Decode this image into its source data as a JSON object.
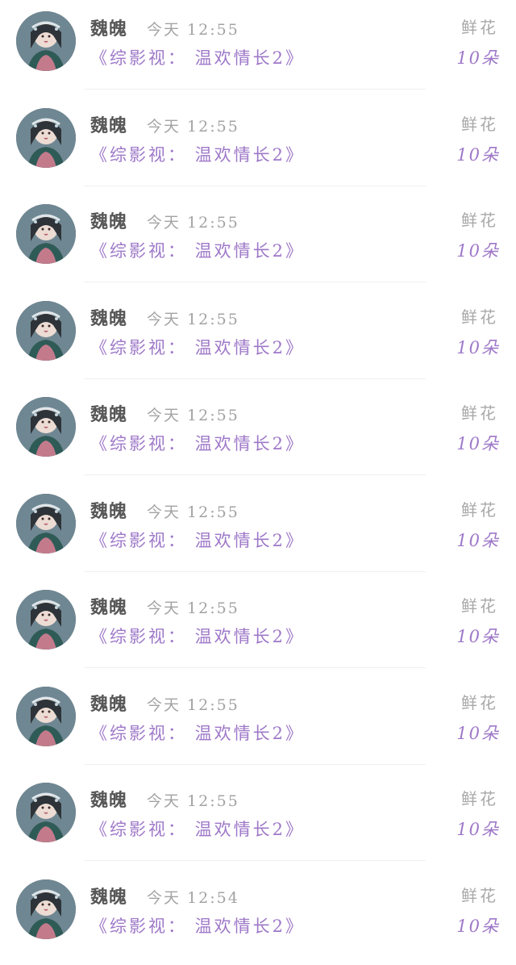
{
  "rows": [
    {
      "name": "魏魄",
      "time": "今天 12:55",
      "novel": "《综影视： 温欢情长2》",
      "gift": "鲜花",
      "count": "10朵"
    },
    {
      "name": "魏魄",
      "time": "今天 12:55",
      "novel": "《综影视： 温欢情长2》",
      "gift": "鲜花",
      "count": "10朵"
    },
    {
      "name": "魏魄",
      "time": "今天 12:55",
      "novel": "《综影视： 温欢情长2》",
      "gift": "鲜花",
      "count": "10朵"
    },
    {
      "name": "魏魄",
      "time": "今天 12:55",
      "novel": "《综影视： 温欢情长2》",
      "gift": "鲜花",
      "count": "10朵"
    },
    {
      "name": "魏魄",
      "time": "今天 12:55",
      "novel": "《综影视： 温欢情长2》",
      "gift": "鲜花",
      "count": "10朵"
    },
    {
      "name": "魏魄",
      "time": "今天 12:55",
      "novel": "《综影视： 温欢情长2》",
      "gift": "鲜花",
      "count": "10朵"
    },
    {
      "name": "魏魄",
      "time": "今天 12:55",
      "novel": "《综影视： 温欢情长2》",
      "gift": "鲜花",
      "count": "10朵"
    },
    {
      "name": "魏魄",
      "time": "今天 12:55",
      "novel": "《综影视： 温欢情长2》",
      "gift": "鲜花",
      "count": "10朵"
    },
    {
      "name": "魏魄",
      "time": "今天 12:55",
      "novel": "《综影视： 温欢情长2》",
      "gift": "鲜花",
      "count": "10朵"
    },
    {
      "name": "魏魄",
      "time": "今天 12:54",
      "novel": "《综影视： 温欢情长2》",
      "gift": "鲜花",
      "count": "10朵"
    }
  ],
  "colors": {
    "accent_purple": "#9e78c8",
    "name_gray": "#575757",
    "meta_gray": "#a3a3a3"
  }
}
